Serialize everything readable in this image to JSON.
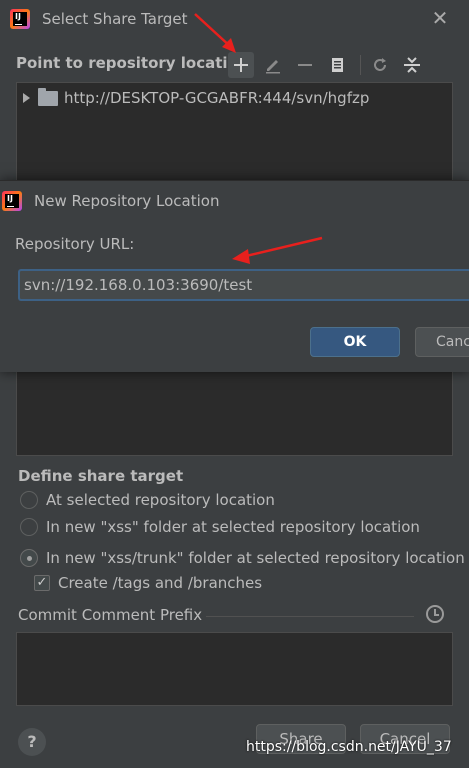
{
  "outer_dialog": {
    "title": "Select Share Target",
    "repository_section_label": "Point to repository location",
    "toolbar": [
      "add-icon",
      "edit-icon",
      "remove-icon",
      "copy-icon",
      "refresh-icon",
      "collapse-all-icon"
    ],
    "tree_root": "http://DESKTOP-GCGABFR:444/svn/hgfzp",
    "share_target_title": "Define share target",
    "options": [
      "At selected repository location",
      "In new \"xss\" folder at selected repository location",
      "In new \"xss/trunk\" folder at selected repository location"
    ],
    "selected_option_index": 2,
    "create_tags_label": "Create /tags and /branches",
    "create_tags_checked": true,
    "commit_prefix_label": "Commit Comment Prefix",
    "commit_prefix_value": "",
    "share_button": "Share",
    "cancel_button": "Cancel",
    "help_label": "?"
  },
  "inner_dialog": {
    "title": "New Repository Location",
    "url_label": "Repository URL:",
    "url_value": "svn://192.168.0.103:3690/test",
    "ok_button": "OK",
    "cancel_button": "Cancel"
  },
  "watermark": "https://blog.csdn.net/JAYU_37",
  "colors": {
    "background": "#3c3f41",
    "field_background": "#2b2b2b",
    "ok_button": "#365880",
    "annotation_arrow": "#e8201d"
  }
}
